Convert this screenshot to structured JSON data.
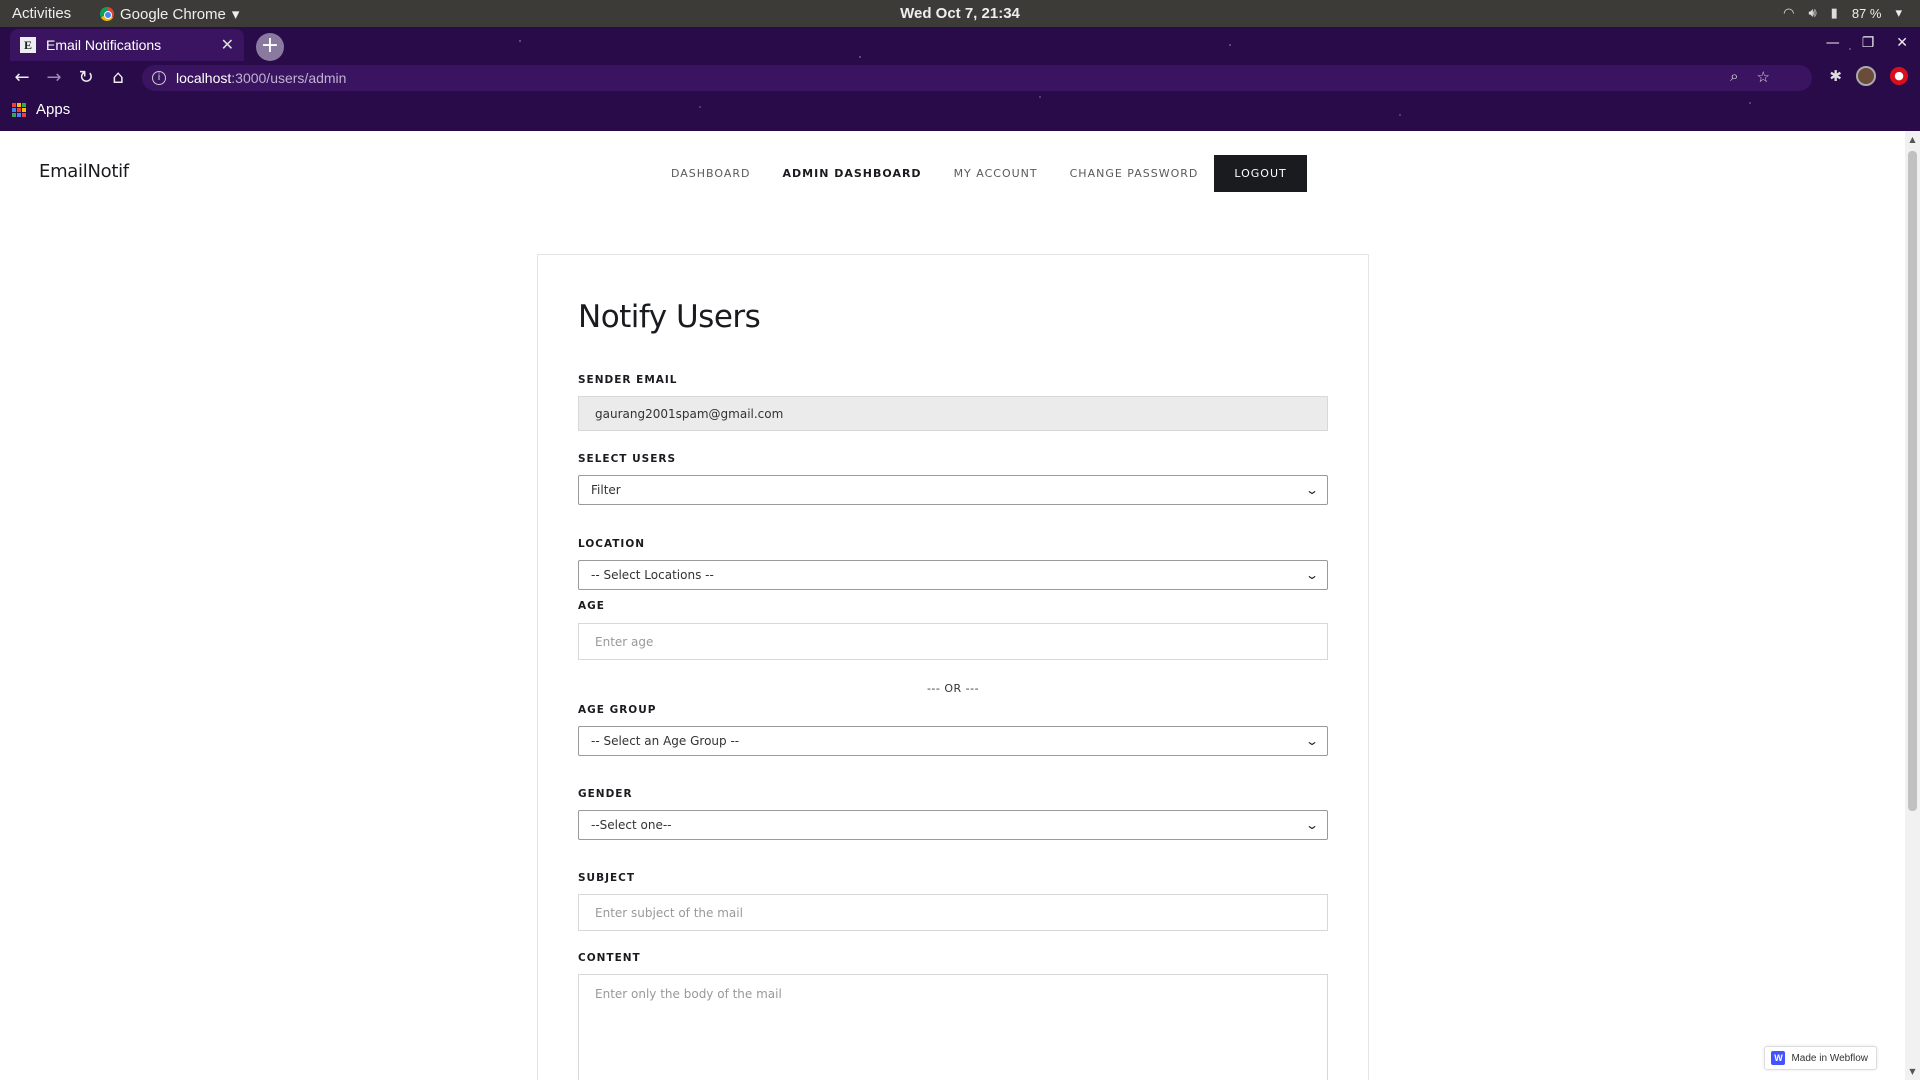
{
  "os": {
    "activities": "Activities",
    "app_name": "Google Chrome",
    "clock": "Wed Oct  7, 21:34",
    "battery": "87 %"
  },
  "browser": {
    "tab_title": "Email Notifications",
    "tab_favicon": "E",
    "url_host": "localhost",
    "url_path": ":3000/users/admin",
    "bookmark_apps": "Apps"
  },
  "app": {
    "brand": "EmailNotif",
    "nav": {
      "dashboard": "DASHBOARD",
      "admin_dashboard": "ADMIN DASHBOARD",
      "my_account": "MY ACCOUNT",
      "change_password": "CHANGE PASSWORD",
      "logout": "LOGOUT"
    }
  },
  "form": {
    "heading": "Notify Users",
    "sender_label": "SENDER EMAIL",
    "sender_value": "gaurang2001spam@gmail.com",
    "users_label": "SELECT USERS",
    "users_value": "Filter",
    "location_label": "LOCATION",
    "location_value": "-- Select Locations --",
    "age_label": "AGE",
    "age_placeholder": "Enter age",
    "or_text": "--- OR ---",
    "age_group_label": "AGE GROUP",
    "age_group_value": "-- Select an Age Group --",
    "gender_label": "GENDER",
    "gender_value": "--Select one--",
    "subject_label": "SUBJECT",
    "subject_placeholder": "Enter subject of the mail",
    "content_label": "CONTENT",
    "content_placeholder": "Enter only the body of the mail"
  },
  "badge": {
    "text": "Made in Webflow",
    "logo": "W"
  },
  "colors": {
    "chrome_frame": "#2a0b4a",
    "logout_bg": "#1a1b1f",
    "webflow_blue": "#4353ff"
  }
}
